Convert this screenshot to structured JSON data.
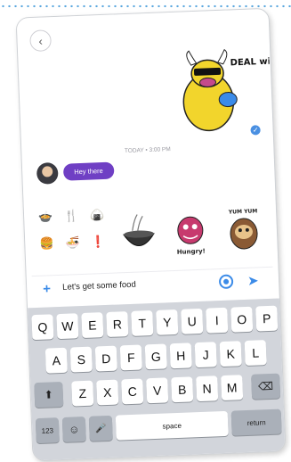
{
  "colors": {
    "accent": "#3b8be8",
    "bubble": "#6f3fc4",
    "keyboard_bg": "#d2d5db"
  },
  "header": {
    "back_icon": "‹"
  },
  "stickers": {
    "big_sticker_text": "DEAL with IT"
  },
  "chat": {
    "timestamp": "TODAY • 3:00 PM",
    "incoming_message": "Hey there",
    "read_receipt_icon": "✓"
  },
  "picker": {
    "emoji_row1": [
      "🍲",
      "🍴",
      "🍙"
    ],
    "emoji_row2": [
      "🍔",
      "🍜",
      "❗"
    ],
    "sticker2_text": "Hungry!",
    "sticker3_text": "YUM YUM"
  },
  "composer": {
    "plus_icon": "+",
    "message_value": "Let's get some food",
    "send_icon": "➤"
  },
  "keyboard": {
    "row1": [
      "Q",
      "W",
      "E",
      "R",
      "T",
      "Y",
      "U",
      "I",
      "O",
      "P"
    ],
    "row2": [
      "A",
      "S",
      "D",
      "F",
      "G",
      "H",
      "J",
      "K",
      "L"
    ],
    "row3": [
      "Z",
      "X",
      "C",
      "V",
      "B",
      "N",
      "M"
    ],
    "shift_icon": "⬆",
    "backspace_icon": "⌫",
    "numbers_label": "123",
    "emoji_key_icon": "☺",
    "mic_icon": "🎤",
    "space_label": "space",
    "return_label": "return"
  }
}
